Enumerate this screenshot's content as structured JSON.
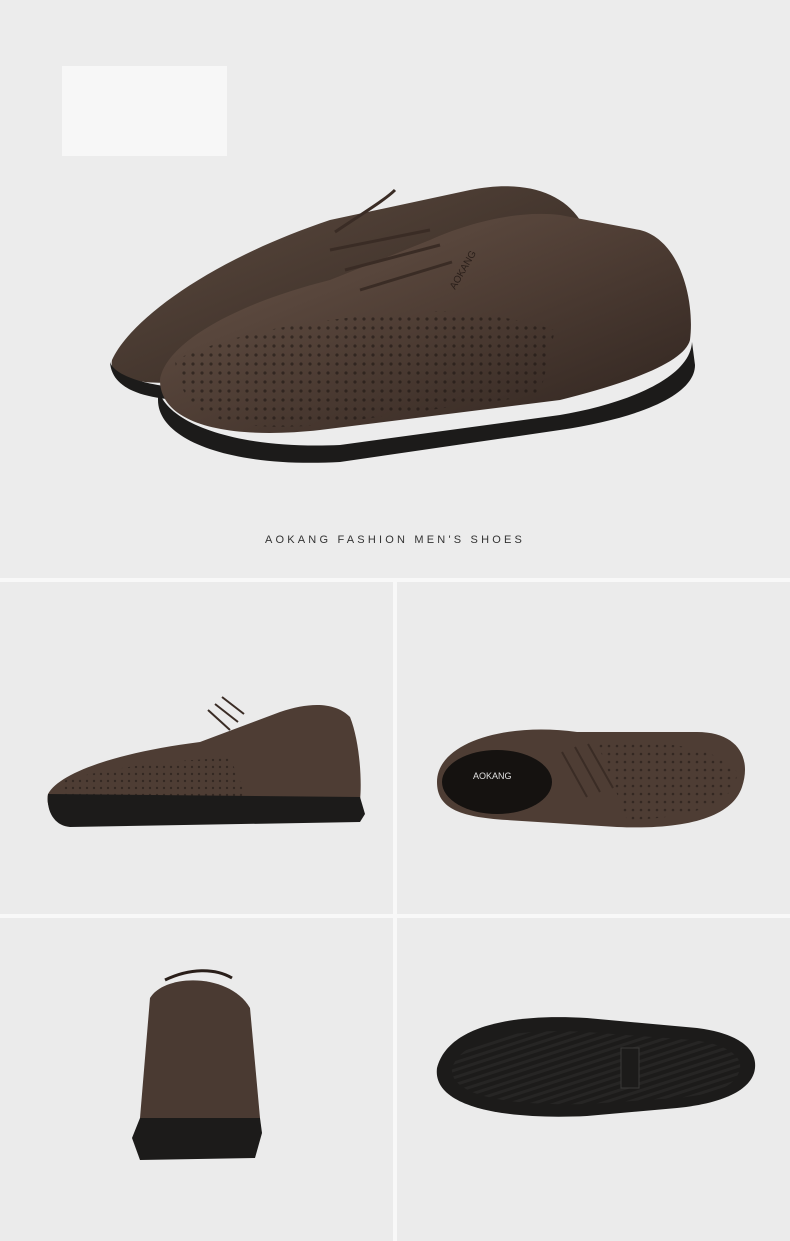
{
  "hero": {
    "caption": "AOKANG FASHION MEN'S SHOES",
    "shoe_brand": "AOKANG"
  },
  "gallery": {
    "insole_brand": "AOKANG"
  },
  "colors": {
    "background": "#ebebeb",
    "leather": "#4a3a32",
    "sole": "#1c1b1a"
  }
}
